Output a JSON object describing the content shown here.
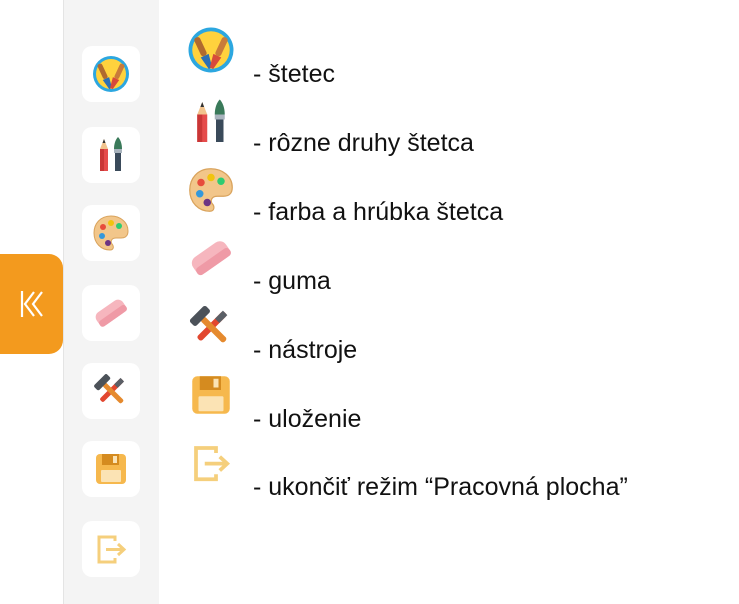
{
  "sidebar": {
    "collapse_icon": "double-chevron-left-icon",
    "buttons": [
      {
        "icon": "brush-icon"
      },
      {
        "icon": "brush-types-icon"
      },
      {
        "icon": "palette-icon"
      },
      {
        "icon": "eraser-icon"
      },
      {
        "icon": "tools-icon"
      },
      {
        "icon": "save-icon"
      },
      {
        "icon": "exit-icon"
      }
    ]
  },
  "legend": [
    {
      "icon": "brush-icon",
      "text": "- štetec"
    },
    {
      "icon": "brush-types-icon",
      "text": "- rôzne druhy štetca"
    },
    {
      "icon": "palette-icon",
      "text": "- farba a hrúbka štetca"
    },
    {
      "icon": "eraser-icon",
      "text": "- guma"
    },
    {
      "icon": "tools-icon",
      "text": "- nástroje"
    },
    {
      "icon": "save-icon",
      "text": "- uloženie"
    },
    {
      "icon": "exit-icon",
      "text": "- ukončiť režim “Pracovná plocha”"
    }
  ],
  "colors": {
    "accent": "#f39a1e",
    "sidebar_bg": "#f4f4f4"
  }
}
